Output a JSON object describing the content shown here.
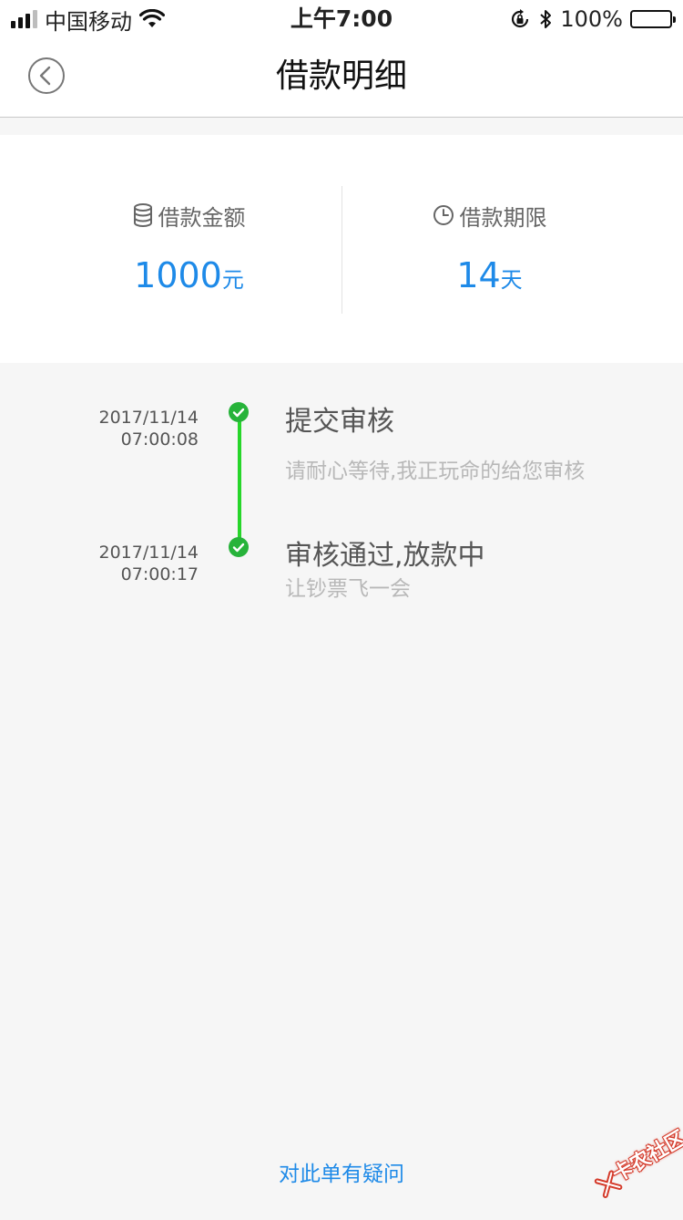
{
  "status_bar": {
    "carrier": "中国移动",
    "time": "上午7:00",
    "battery": "100%"
  },
  "nav": {
    "title": "借款明细"
  },
  "summary": {
    "amount_label": "借款金额",
    "amount_value": "1000",
    "amount_unit": "元",
    "term_label": "借款期限",
    "term_value": "14",
    "term_unit": "天",
    "accent_color": "#1e8ae8"
  },
  "timeline": [
    {
      "date": "2017/11/14",
      "time": "07:00:08",
      "title": "提交审核",
      "desc": "请耐心等待,我正玩命的给您审核"
    },
    {
      "date": "2017/11/14",
      "time": "07:00:17",
      "title": "审核通过,放款中",
      "desc": "让钞票飞一会"
    }
  ],
  "timeline_color": "#27d62a",
  "footer": {
    "question_link": "对此单有疑问"
  },
  "watermark": {
    "text": "卡农社区"
  }
}
